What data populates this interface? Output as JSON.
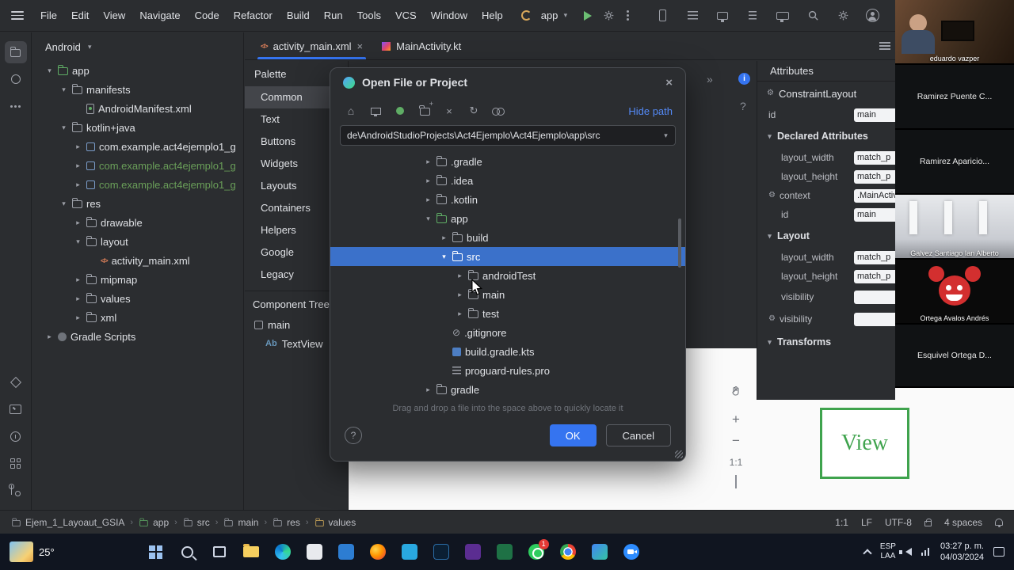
{
  "menubar": {
    "items": [
      "File",
      "Edit",
      "View",
      "Navigate",
      "Code",
      "Refactor",
      "Build",
      "Run",
      "Tools",
      "VCS",
      "Window",
      "Help"
    ],
    "run_config": "app"
  },
  "tabs": [
    {
      "label": "activity_main.xml"
    },
    {
      "label": "MainActivity.kt"
    }
  ],
  "project": {
    "view_selector": "Android",
    "items": [
      {
        "label": "app"
      },
      {
        "label": "manifests"
      },
      {
        "label": "AndroidManifest.xml"
      },
      {
        "label": "kotlin+java"
      },
      {
        "label": "com.example.act4ejemplo1_g"
      },
      {
        "label": "com.example.act4ejemplo1_g"
      },
      {
        "label": "com.example.act4ejemplo1_g"
      },
      {
        "label": "res"
      },
      {
        "label": "drawable"
      },
      {
        "label": "layout"
      },
      {
        "label": "activity_main.xml"
      },
      {
        "label": "mipmap"
      },
      {
        "label": "values"
      },
      {
        "label": "xml"
      },
      {
        "label": "Gradle Scripts"
      }
    ]
  },
  "palette": {
    "title": "Palette",
    "categories": [
      "Common",
      "Text",
      "Buttons",
      "Widgets",
      "Layouts",
      "Containers",
      "Helpers",
      "Google",
      "Legacy"
    ]
  },
  "component_tree": {
    "title": "Component Tree",
    "items": [
      {
        "label": "main",
        "badge": ""
      },
      {
        "label": "TextView",
        "badge": "Ab"
      }
    ]
  },
  "dialog": {
    "title": "Open File or Project",
    "hide_path_label": "Hide path",
    "path_value": "de\\AndroidStudioProjects\\Act4Ejemplo\\Act4Ejemplo\\app\\src",
    "tree": [
      {
        "label": ".gradle"
      },
      {
        "label": ".idea"
      },
      {
        "label": ".kotlin"
      },
      {
        "label": "app"
      },
      {
        "label": "build"
      },
      {
        "label": "src"
      },
      {
        "label": "androidTest"
      },
      {
        "label": "main"
      },
      {
        "label": "test"
      },
      {
        "label": ".gitignore"
      },
      {
        "label": "build.gradle.kts"
      },
      {
        "label": "proguard-rules.pro"
      },
      {
        "label": "gradle"
      }
    ],
    "hint": "Drag and drop a file into the space above to quickly locate it",
    "help_label": "?",
    "ok_label": "OK",
    "cancel_label": "Cancel"
  },
  "design": {
    "zoom_label": "1:1",
    "help_label": "?",
    "preview_text": "View"
  },
  "attributes": {
    "title": "Attributes",
    "component_name": "ConstraintLayout",
    "top_id_label": "id",
    "top_id_value": "main",
    "declared": {
      "title": "Declared Attributes",
      "rows": [
        {
          "label": "layout_width",
          "value": "match_p"
        },
        {
          "label": "layout_height",
          "value": "match_p"
        },
        {
          "label": "context",
          "value": ".MainActiv"
        },
        {
          "label": "id",
          "value": "main"
        }
      ]
    },
    "layout": {
      "title": "Layout",
      "rows": [
        {
          "label": "layout_width",
          "value": "match_p"
        },
        {
          "label": "layout_height",
          "value": "match_p"
        },
        {
          "label": "visibility",
          "value": ""
        },
        {
          "label": "visibility",
          "value": ""
        }
      ]
    },
    "transforms": {
      "title": "Transforms"
    }
  },
  "video_panel": {
    "participants": [
      {
        "name": "eduardo vazper"
      },
      {
        "name": "Ramirez Puente C..."
      },
      {
        "name": "Ramirez Aparicio..."
      },
      {
        "name": "Galvez Santiago Ian Alberto"
      },
      {
        "name": "Ortega Avalos Andrés"
      },
      {
        "name": "Esquivel Ortega D..."
      }
    ]
  },
  "status_bar": {
    "project_crumb": "Ejem_1_Layoaut_GSIA",
    "crumbs": [
      "app",
      "src",
      "main",
      "res",
      "values"
    ],
    "right_items": [
      "1:1",
      "LF",
      "UTF-8",
      "4 spaces"
    ]
  },
  "taskbar": {
    "weather_temp": "25°",
    "lang_top": "ESP",
    "lang_bottom": "LAA",
    "clock_time": "03:27 p. m.",
    "clock_date": "04/03/2024",
    "whatsapp_badge": "1"
  },
  "colors": {
    "accent_blue": "#3574f0",
    "selection_blue": "#3b71ca",
    "android_green": "#3ddc84",
    "test_package_green": "#6a9f59",
    "preview_green": "#3fa34d",
    "whatsapp_green": "#2ecc5e",
    "badge_red": "#e53935"
  }
}
